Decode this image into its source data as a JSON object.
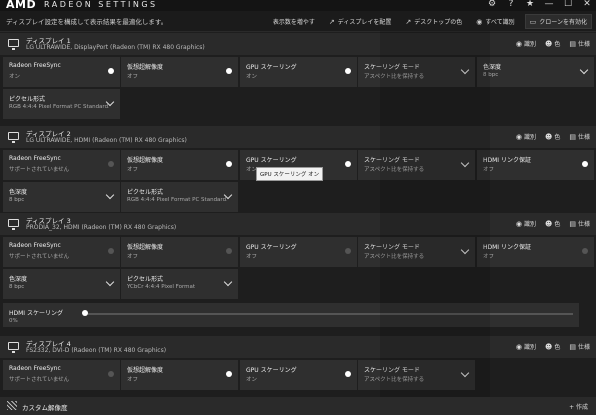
{
  "app": {
    "brand": "AMD",
    "title": "RADEON SETTINGS"
  },
  "window_controls": [
    "⚙",
    "?",
    "★",
    "—",
    "☐",
    "✕"
  ],
  "toolbar": {
    "description": "ディスプレイ設定を構成して表示結果を最適化します。",
    "actions": [
      {
        "label": "表示数を増やす",
        "icon": ""
      },
      {
        "label": "ディスプレイを配置",
        "icon": "↗"
      },
      {
        "label": "デスクトップの色",
        "icon": "↗"
      },
      {
        "label": "すべて識別",
        "icon": "◉"
      },
      {
        "label": "クローンを有効化",
        "icon": "▭"
      }
    ]
  },
  "display_links": {
    "identify": "識別",
    "color": "色",
    "specs": "仕様",
    "add": "作成"
  },
  "displays": [
    {
      "title": "ディスプレイ 1",
      "subtitle": "LG ULTRAWIDE, DisplayPort (Radeon (TM) RX 480 Graphics)",
      "row1": [
        {
          "label": "Radeon FreeSync",
          "value": "オン",
          "control": "toggle-on"
        },
        {
          "label": "仮想超解像度",
          "value": "オフ",
          "control": "toggle-on"
        },
        {
          "label": "GPU スケーリング",
          "value": "オン",
          "control": "toggle-on"
        },
        {
          "label": "スケーリング モード",
          "value": "アスペクト比を保持する",
          "control": "dropdown"
        },
        {
          "label": "色深度",
          "value": "8 bpc",
          "control": "dropdown"
        }
      ],
      "row2": [
        {
          "label": "ピクセル形式",
          "value": "RGB 4:4:4 Pixel Format PC Standard...",
          "control": "dropdown"
        }
      ]
    },
    {
      "title": "ディスプレイ 2",
      "subtitle": "LG ULTRAWIDE, HDMI (Radeon (TM) RX 480 Graphics)",
      "row1": [
        {
          "label": "Radeon FreeSync",
          "value": "サポートされていません",
          "control": "toggle-off"
        },
        {
          "label": "仮想超解像度",
          "value": "オフ",
          "control": "toggle-on"
        },
        {
          "label": "GPU スケーリング",
          "value": "オン",
          "control": "toggle-on"
        },
        {
          "label": "スケーリング モード",
          "value": "アスペクト比を保持する",
          "control": "dropdown"
        },
        {
          "label": "HDMI リンク保証",
          "value": "オフ",
          "control": "toggle-on"
        }
      ],
      "row2": [
        {
          "label": "色深度",
          "value": "8 bpc",
          "control": "dropdown"
        },
        {
          "label": "ピクセル形式",
          "value": "RGB 4:4:4 Pixel Format PC Standard...",
          "control": "dropdown"
        }
      ],
      "tooltip": "GPU スケーリング オン"
    },
    {
      "title": "ディスプレイ 3",
      "subtitle": "PRODIA_32, HDMI (Radeon (TM) RX 480 Graphics)",
      "row1": [
        {
          "label": "Radeon FreeSync",
          "value": "サポートされていません",
          "control": "toggle-off"
        },
        {
          "label": "仮想超解像度",
          "value": "オフ",
          "control": "toggle-off"
        },
        {
          "label": "GPU スケーリング",
          "value": "オフ",
          "control": "toggle-off"
        },
        {
          "label": "スケーリング モード",
          "value": "アスペクト比を保持する",
          "control": "dropdown"
        },
        {
          "label": "HDMI リンク保証",
          "value": "オフ",
          "control": "toggle-off"
        }
      ],
      "row2": [
        {
          "label": "色深度",
          "value": "8 bpc",
          "control": "dropdown"
        },
        {
          "label": "ピクセル形式",
          "value": "YCbCr 4:4:4 Pixel Format",
          "control": "dropdown"
        }
      ],
      "hdmi_scaling": {
        "label": "HDMI スケーリング",
        "value": "0%",
        "level": 0
      }
    },
    {
      "title": "ディスプレイ 4",
      "subtitle": "FS2332, DVI-D (Radeon (TM) RX 480 Graphics)",
      "row1": [
        {
          "label": "Radeon FreeSync",
          "value": "サポートされていません",
          "control": "toggle-off"
        },
        {
          "label": "仮想超解像度",
          "value": "オフ",
          "control": "toggle-on"
        },
        {
          "label": "GPU スケーリング",
          "value": "オン",
          "control": "toggle-on"
        },
        {
          "label": "スケーリング モード",
          "value": "アスペクト比を保持する",
          "control": "dropdown"
        }
      ],
      "row2": []
    }
  ],
  "custom_resolution": {
    "title": "カスタム解像度",
    "add": "+ 作成"
  }
}
